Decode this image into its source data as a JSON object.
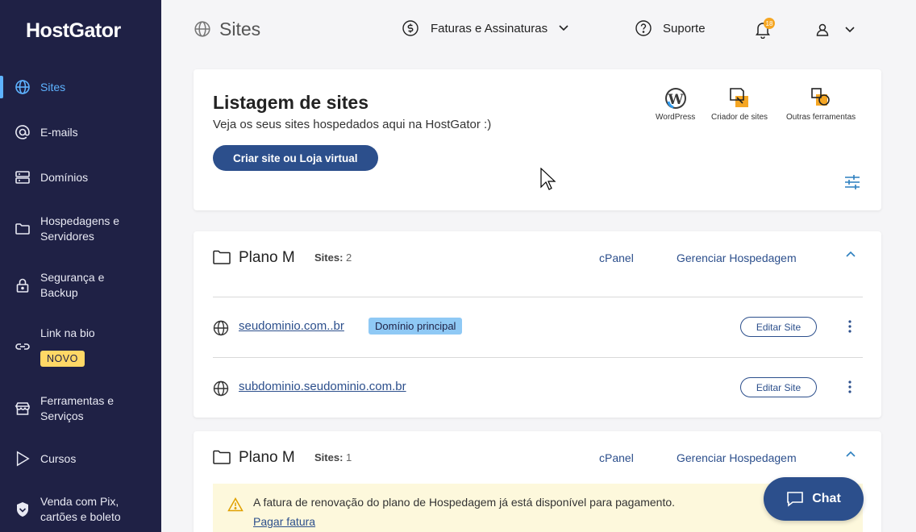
{
  "brand": {
    "name": "HostGator"
  },
  "sidebar": {
    "items": [
      {
        "label": "Sites",
        "icon": "globe-icon",
        "active": true
      },
      {
        "label": "E-mails",
        "icon": "at-icon"
      },
      {
        "label": "Domínios",
        "icon": "server-icon"
      },
      {
        "label": "Hospedagens e Servidores",
        "icon": "folder-icon"
      },
      {
        "label": "Segurança e Backup",
        "icon": "lock-icon"
      },
      {
        "label": "Link na bio",
        "icon": "link-icon",
        "badge": "NOVO"
      },
      {
        "label": "Ferramentas e Serviços",
        "icon": "store-icon"
      },
      {
        "label": "Cursos",
        "icon": "play-icon"
      },
      {
        "label": "Venda com Pix, cartões e boleto",
        "icon": "shield-icon"
      }
    ]
  },
  "header": {
    "title": "Sites",
    "billing": "Faturas e Assinaturas",
    "support": "Suporte",
    "notifications_count": "18"
  },
  "listing": {
    "title": "Listagem de sites",
    "subtitle": "Veja os seus sites hospedados aqui na HostGator :)",
    "create_button": "Criar site ou Loja virtual",
    "tools": [
      {
        "label": "WordPress",
        "icon": "wordpress-icon"
      },
      {
        "label": "Criador de sites",
        "icon": "site-builder-icon"
      },
      {
        "label": "Outras ferramentas",
        "icon": "tools-icon"
      }
    ]
  },
  "plans": [
    {
      "name": "Plano M",
      "sites_label": "Sites:",
      "sites_count": "2",
      "cpanel": "cPanel",
      "manage": "Gerenciar Hospedagem",
      "sites": [
        {
          "domain": "seudominio.com..br",
          "badge": "Domínio principal",
          "edit": "Editar Site"
        },
        {
          "domain": "subdominio.seudominio.com.br",
          "edit": "Editar Site"
        }
      ]
    },
    {
      "name": "Plano M",
      "sites_label": "Sites:",
      "sites_count": "1",
      "cpanel": "cPanel",
      "manage": "Gerenciar Hospedagem",
      "alert": {
        "text": "A fatura de renovação do plano de Hospedagem já está disponível para pagamento.",
        "link": "Pagar fatura"
      }
    }
  ],
  "chat": {
    "label": "Chat"
  },
  "colors": {
    "sidebar": "#1f2145",
    "accent": "#2c4f8c",
    "active": "#5eb3ff",
    "badge": "#ffd866",
    "alert_bg": "#fdf8dc"
  }
}
